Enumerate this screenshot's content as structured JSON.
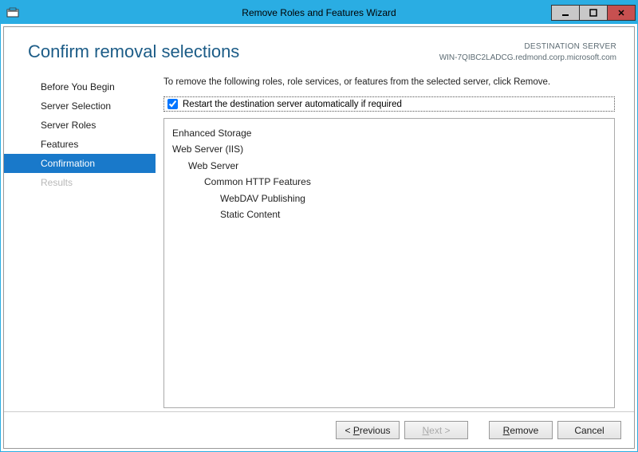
{
  "window": {
    "title": "Remove Roles and Features Wizard"
  },
  "header": {
    "page_title": "Confirm removal selections",
    "dest_label": "DESTINATION SERVER",
    "dest_value": "WIN-7QIBC2LADCG.redmond.corp.microsoft.com"
  },
  "nav": {
    "steps": [
      {
        "label": "Before You Begin"
      },
      {
        "label": "Server Selection"
      },
      {
        "label": "Server Roles"
      },
      {
        "label": "Features"
      },
      {
        "label": "Confirmation"
      },
      {
        "label": "Results"
      }
    ]
  },
  "content": {
    "description": "To remove the following roles, role services, or features from the selected server, click Remove.",
    "restart_label": "Restart the destination server automatically if required",
    "restart_checked": true,
    "items": [
      {
        "text": "Enhanced Storage",
        "indent": 0
      },
      {
        "text": "Web Server (IIS)",
        "indent": 0
      },
      {
        "text": "Web Server",
        "indent": 1
      },
      {
        "text": "Common HTTP Features",
        "indent": 2
      },
      {
        "text": "WebDAV Publishing",
        "indent": 3
      },
      {
        "text": "Static Content",
        "indent": 3
      }
    ]
  },
  "footer": {
    "previous": "Previous",
    "next": "ext >",
    "next_prefix": "N",
    "remove": "emove",
    "remove_prefix": "R",
    "cancel": "Cancel"
  }
}
